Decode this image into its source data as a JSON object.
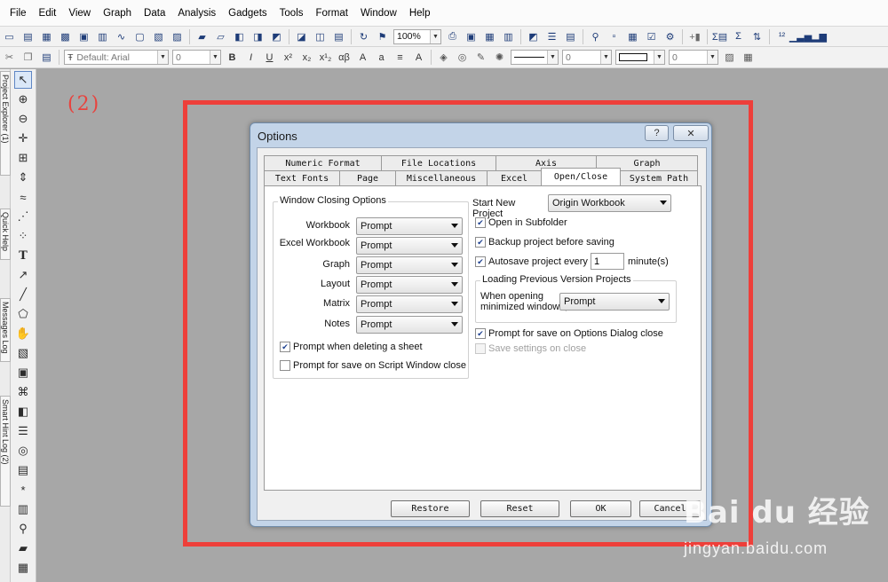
{
  "menu": [
    "File",
    "Edit",
    "View",
    "Graph",
    "Data",
    "Analysis",
    "Gadgets",
    "Tools",
    "Format",
    "Window",
    "Help"
  ],
  "toolbar": {
    "zoom": "100%",
    "font": "Default: Arial",
    "font_size": "0",
    "line_width": "0",
    "pattern_value": "0"
  },
  "left_tabs": [
    "Project Explorer (1)",
    "Quick Help",
    "Messages Log",
    "Smart Hint Log (2)"
  ],
  "step_label": "(2)",
  "dialog": {
    "title": "Options",
    "help_glyph": "?",
    "close_glyph": "✕",
    "tabs_row1": [
      "Numeric Format",
      "File Locations",
      "Axis",
      "Graph"
    ],
    "tabs_row2": [
      "Text Fonts",
      "Page",
      "Miscellaneous",
      "Excel",
      "Open/Close",
      "System Path"
    ],
    "active_tab": "Open/Close",
    "window_closing": {
      "title": "Window Closing Options",
      "rows": [
        {
          "label": "Workbook",
          "value": "Prompt"
        },
        {
          "label": "Excel Workbook",
          "value": "Prompt"
        },
        {
          "label": "Graph",
          "value": "Prompt"
        },
        {
          "label": "Layout",
          "value": "Prompt"
        },
        {
          "label": "Matrix",
          "value": "Prompt"
        },
        {
          "label": "Notes",
          "value": "Prompt"
        }
      ],
      "prompt_delete_sheet": {
        "label": "Prompt when deleting a sheet",
        "checked": true
      },
      "prompt_save_script": {
        "label": "Prompt for save on Script Window close",
        "checked": false
      }
    },
    "start_new_project": {
      "label": "Start New Project",
      "value": "Origin Workbook"
    },
    "open_in_subfolder": {
      "label": "Open in Subfolder",
      "checked": true
    },
    "backup_project": {
      "label": "Backup project before saving",
      "checked": true
    },
    "autosave": {
      "label": "Autosave project every",
      "value": "1",
      "unit": "minute(s)",
      "checked": true
    },
    "loading_previous": {
      "title": "Loading Previous Version Projects",
      "label_line1": "When opening",
      "label_line2": "minimized windows,",
      "value": "Prompt"
    },
    "prompt_save_options": {
      "label": "Prompt for save on Options Dialog close",
      "checked": true
    },
    "save_settings_on_close": {
      "label": "Save settings on close",
      "checked": false,
      "disabled": true
    },
    "buttons": {
      "restore": "Restore",
      "reset": "Reset",
      "ok": "OK",
      "cancel": "Cancel"
    }
  },
  "watermark": {
    "logo": "Bai du 经验",
    "url": "jingyan.baidu.com"
  }
}
